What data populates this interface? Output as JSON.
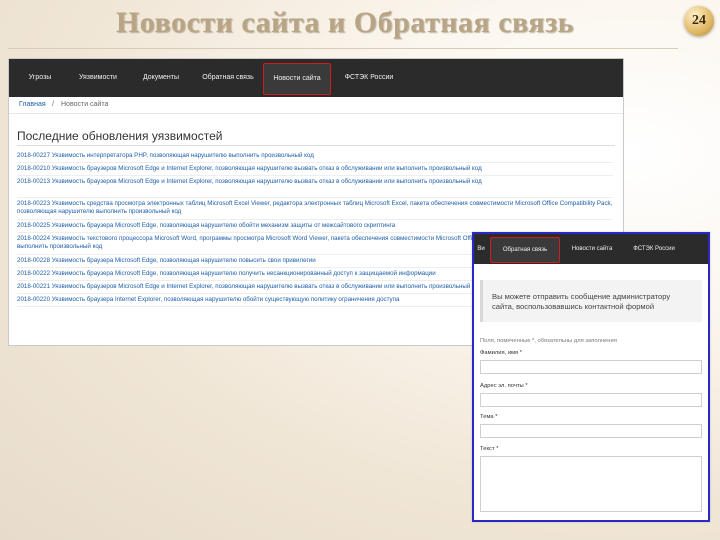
{
  "slide": {
    "title": "Новости сайта и Обратная связь",
    "page_number": "24"
  },
  "site_nav": {
    "items": [
      "Угрозы",
      "Уязвимости",
      "Документы",
      "Обратная связь",
      "Новости сайта",
      "ФСТЭК России"
    ],
    "active": "Новости сайта",
    "active_color": "#d21b1b",
    "nav_background": "#2b2b2b"
  },
  "breadcrumb": {
    "home": "Главная",
    "separator": "/",
    "current": "Новости сайта"
  },
  "news": {
    "heading": "Последние обновления уязвимостей",
    "items": [
      "2018-00227 Уязвимость интерпретатора PHP, позволяющая нарушителю выполнить произвольный код",
      "2018-00210 Уязвимость браузеров Microsoft Edge и Internet Explorer, позволяющая нарушителю вызвать отказ в обслуживании или выполнить произвольный код",
      "2018-00213 Уязвимость браузеров Microsoft Edge и Internet Explorer, позволяющая нарушителю вызвать отказ в обслуживании или выполнить произвольный код",
      "2018-00223 Уязвимость средства просмотра электронных таблиц Microsoft Excel Viewer, редактора электронных таблиц Microsoft Excel, пакета обеспечения совместимости Microsoft Office Compatibility Pack, позволяющая нарушителю выполнить произвольный код",
      "2018-00225 Уязвимость браузера Microsoft Edge, позволяющая нарушителю обойти механизм защиты от межсайтового скриптинга",
      "2018-00224 Уязвимость текстового процессора Microsoft Word, программы просмотра Microsoft Word Viewer, пакета обеспечения совместимости Microsoft Office Compatibility Pack, позволяющая нарушителю выполнить произвольный код",
      "2018-00228 Уязвимость браузера Microsoft Edge, позволяющая нарушителю повысить свои привилегии",
      "2018-00222 Уязвимость браузера Microsoft Edge, позволяющая нарушителю получить несанкционированный доступ к защищаемой информации",
      "2018-00221 Уязвимость браузеров Microsoft Edge и Internet Explorer, позволяющая нарушителю вызвать отказ в обслуживании или выполнить произвольный код",
      "2018-00220 Уязвимость браузера Internet Explorer, позволяющая нарушителю обойти существующую политику ограничения доступа"
    ]
  },
  "feedback": {
    "nav_items": [
      "Ви",
      "Обратная связь",
      "Новости сайта",
      "ФСТЭК России"
    ],
    "active": "Обратная связь",
    "info_text": "Вы можете отправить сообщение администратору сайта, воспользовавшись контактной формой",
    "required_note": "Поля, помеченные *, обязательны для заполнения",
    "fields": [
      {
        "label": "Фамилия, имя *"
      },
      {
        "label": "Адрес эл. почты *"
      },
      {
        "label": "Тема *"
      },
      {
        "label": "Текст *"
      }
    ],
    "border_color": "#2828c8"
  }
}
